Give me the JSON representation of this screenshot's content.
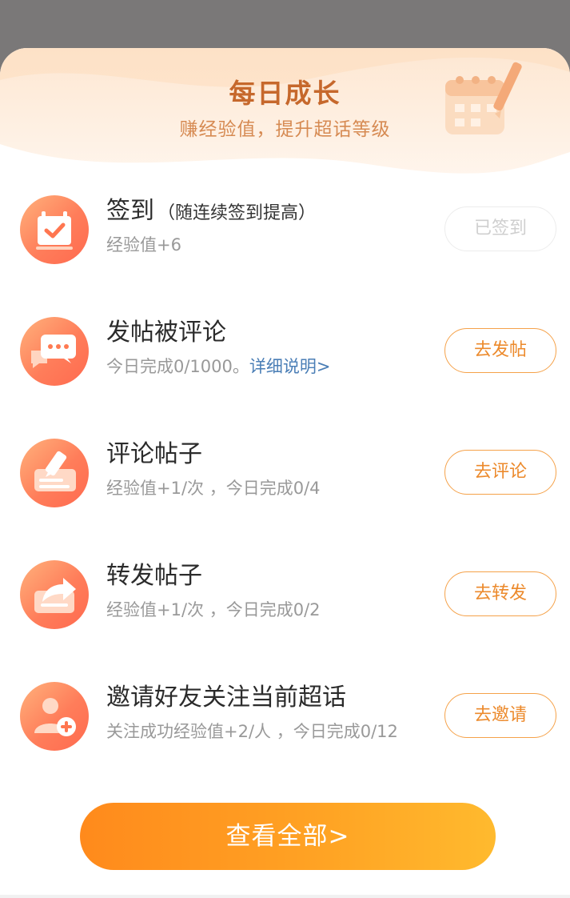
{
  "header": {
    "title": "每日成长",
    "subtitle": "赚经验值，提升超话等级"
  },
  "tasks": [
    {
      "title": "签到",
      "note": "（随连续签到提高）",
      "desc": "经验值+6",
      "button": "已签到",
      "icon": "calendar-check-icon",
      "done": true
    },
    {
      "title": "发帖被评论",
      "desc": "今日完成0/1000。",
      "link": "详细说明>",
      "button": "去发帖",
      "icon": "chat-bubbles-icon"
    },
    {
      "title": "评论帖子",
      "desc": "经验值+1/次 ，今日完成0/4",
      "button": "去评论",
      "icon": "comment-edit-icon"
    },
    {
      "title": "转发帖子",
      "desc": "经验值+1/次 ，今日完成0/2",
      "button": "去转发",
      "icon": "share-forward-icon"
    },
    {
      "title": "邀请好友关注当前超话",
      "desc": "关注成功经验值+2/人 ，今日完成0/12",
      "button": "去邀请",
      "icon": "add-friend-icon"
    }
  ],
  "view_all": "查看全部>",
  "colors": {
    "accent": "#ec8a2c",
    "title": "#c6682c",
    "icon_gradient_start": "#ffb27c",
    "icon_gradient_end": "#ff6a4f",
    "link": "#4a7eb6"
  }
}
